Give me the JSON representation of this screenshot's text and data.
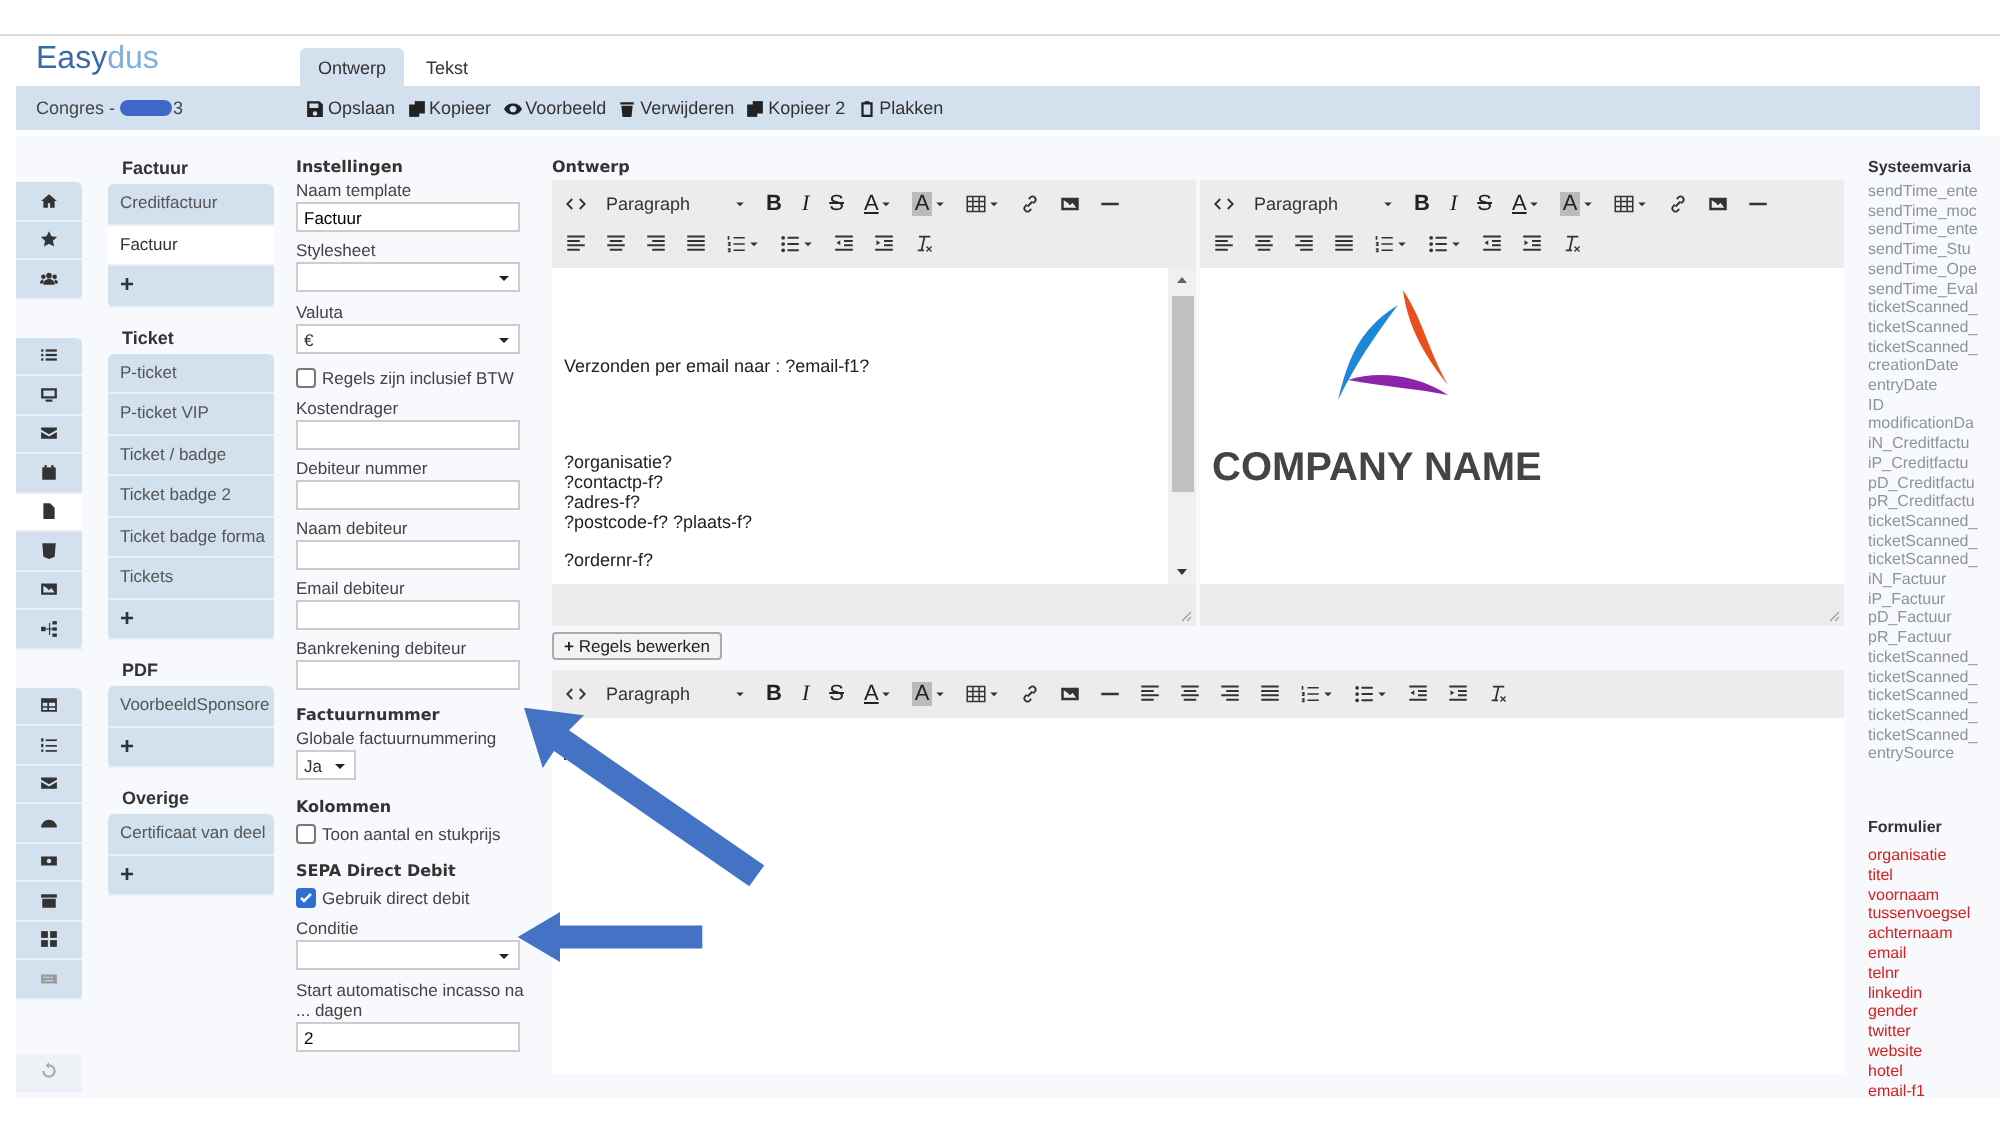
{
  "app": {
    "logo_dark": "Easy",
    "logo_light": "dus"
  },
  "tabs": [
    {
      "label": "Ontwerp",
      "selected": true
    },
    {
      "label": "Tekst",
      "selected": false
    }
  ],
  "project": {
    "name_start": "Congres -",
    "name_end": "3",
    "redacted": true
  },
  "actions": [
    {
      "kind": "save",
      "label": "Opslaan"
    },
    {
      "kind": "copy",
      "label": "Kopieer"
    },
    {
      "kind": "eye",
      "label": "Voorbeeld"
    },
    {
      "kind": "trash",
      "label": "Verwijderen"
    },
    {
      "kind": "copy",
      "label": "Kopieer 2"
    },
    {
      "kind": "paste",
      "label": "Plakken"
    }
  ],
  "nav_groups": [
    [
      {
        "kind": "home",
        "selected": false
      },
      {
        "kind": "star",
        "selected": false
      },
      {
        "kind": "users",
        "selected": false
      }
    ],
    [
      {
        "kind": "list",
        "selected": false
      },
      {
        "kind": "monitor",
        "selected": false
      },
      {
        "kind": "envelope",
        "selected": false
      },
      {
        "kind": "calendar",
        "selected": false
      },
      {
        "kind": "file",
        "selected": true
      },
      {
        "kind": "html5",
        "selected": false
      },
      {
        "kind": "image",
        "selected": false
      },
      {
        "kind": "sitemap",
        "selected": false
      }
    ],
    [
      {
        "kind": "table",
        "selected": false
      },
      {
        "kind": "listol",
        "selected": false
      },
      {
        "kind": "envelope",
        "selected": false
      },
      {
        "kind": "gauge",
        "selected": false
      },
      {
        "kind": "money",
        "selected": false
      },
      {
        "kind": "archive",
        "selected": false
      },
      {
        "kind": "grid",
        "selected": false
      },
      {
        "kind": "keyboard",
        "selected": false,
        "disabled": true
      }
    ]
  ],
  "template_groups": [
    {
      "title": "Factuur",
      "items": [
        {
          "label": "Creditfactuur",
          "selected": false
        },
        {
          "label": "Factuur",
          "selected": true
        }
      ],
      "add": "+"
    },
    {
      "title": "Ticket",
      "items": [
        {
          "label": "P-ticket",
          "selected": false
        },
        {
          "label": "P-ticket VIP",
          "selected": false
        },
        {
          "label": "Ticket / badge",
          "selected": false
        },
        {
          "label": "Ticket badge 2",
          "selected": false
        },
        {
          "label": "Ticket badge forma",
          "selected": false
        },
        {
          "label": "Tickets",
          "selected": false
        }
      ],
      "add": "+"
    },
    {
      "title": "PDF",
      "items": [
        {
          "label": "VoorbeeldSponsore",
          "selected": false
        }
      ],
      "add": "+"
    },
    {
      "title": "Overige",
      "items": [
        {
          "label": "Certificaat van deel",
          "selected": false
        }
      ],
      "add": "+"
    }
  ],
  "settings": [
    {
      "kind": "heading",
      "label": "Instellingen"
    },
    {
      "kind": "text",
      "label": "Naam template",
      "value": "Factuur"
    },
    {
      "kind": "select",
      "label": "Stylesheet"
    },
    {
      "kind": "select",
      "label": "Valuta",
      "value": "€"
    },
    {
      "kind": "checkbox",
      "label": "Regels zijn inclusief BTW",
      "checked": false
    },
    {
      "kind": "text",
      "label": "Kostendrager"
    },
    {
      "kind": "text",
      "label": "Debiteur nummer"
    },
    {
      "kind": "text",
      "label": "Naam debiteur"
    },
    {
      "kind": "text",
      "label": "Email debiteur"
    },
    {
      "kind": "text",
      "label": "Bankrekening debiteur"
    },
    {
      "kind": "heading",
      "label": "Factuurnummer"
    },
    {
      "kind": "smallselect",
      "label": "Globale factuurnummering",
      "value": "Ja"
    },
    {
      "kind": "heading",
      "label": "Kolommen"
    },
    {
      "kind": "checkbox",
      "label": "Toon aantal en stukprijs",
      "checked": false
    },
    {
      "kind": "heading",
      "label": "SEPA Direct Debit"
    },
    {
      "kind": "checkbox",
      "label": "Gebruik direct debit",
      "checked": true
    },
    {
      "kind": "select",
      "label": "Conditie"
    },
    {
      "kind": "text",
      "label": "Start automatische incasso na ... dagen",
      "value": "2"
    }
  ],
  "design": {
    "title": "Ontwerp",
    "editors": [
      {
        "toolbar": [
          [
            {
              "kind": "source"
            },
            {
              "kind": "format",
              "label": "Paragraph"
            },
            {
              "kind": "bold",
              "label": "B"
            },
            {
              "kind": "italic",
              "label": "I"
            },
            {
              "kind": "strike",
              "label": "S"
            },
            {
              "kind": "forecolor",
              "label": "A"
            },
            {
              "kind": "backcolor",
              "label": "A"
            },
            {
              "kind": "table"
            },
            {
              "kind": "link"
            },
            {
              "kind": "image"
            },
            {
              "kind": "hr"
            }
          ],
          [
            {
              "kind": "alignleft"
            },
            {
              "kind": "aligncenter"
            },
            {
              "kind": "alignright"
            },
            {
              "kind": "justify"
            },
            {
              "kind": "numlist"
            },
            {
              "kind": "bullist"
            },
            {
              "kind": "outdent"
            },
            {
              "kind": "indent"
            },
            {
              "kind": "removeformat"
            }
          ]
        ],
        "content": [
          {
            "kind": "para",
            "text": "Verzonden per email naar : ?email-f1?"
          },
          {
            "kind": "para",
            "text": "?organisatie?"
          },
          {
            "kind": "line",
            "text": "?contactp-f?"
          },
          {
            "kind": "line",
            "text": "?adres-f?"
          },
          {
            "kind": "line",
            "text": "?postcode-f? ?plaats-f?"
          },
          {
            "kind": "gap",
            "text": "?ordernr-f?"
          }
        ],
        "scrollbar": true
      },
      {
        "toolbar": [
          [
            {
              "kind": "source"
            },
            {
              "kind": "format",
              "label": "Paragraph"
            },
            {
              "kind": "bold",
              "label": "B"
            },
            {
              "kind": "italic",
              "label": "I"
            },
            {
              "kind": "strike",
              "label": "S"
            },
            {
              "kind": "forecolor",
              "label": "A"
            },
            {
              "kind": "backcolor",
              "label": "A"
            },
            {
              "kind": "table"
            },
            {
              "kind": "link"
            },
            {
              "kind": "image"
            },
            {
              "kind": "hr"
            }
          ],
          [
            {
              "kind": "alignleft"
            },
            {
              "kind": "aligncenter"
            },
            {
              "kind": "alignright"
            },
            {
              "kind": "justify"
            },
            {
              "kind": "numlist"
            },
            {
              "kind": "bullist"
            },
            {
              "kind": "outdent"
            },
            {
              "kind": "indent"
            },
            {
              "kind": "removeformat"
            }
          ]
        ],
        "content": [
          {
            "kind": "logo",
            "text": "COMPANY NAME"
          }
        ],
        "scrollbar": false
      }
    ],
    "rules_button": {
      "icon": "+",
      "label": "Regels bewerken"
    },
    "lines_editor": {
      "toolbar": [
        [
          {
            "kind": "source"
          },
          {
            "kind": "format",
            "label": "Paragraph"
          },
          {
            "kind": "bold",
            "label": "B"
          },
          {
            "kind": "italic",
            "label": "I"
          },
          {
            "kind": "strike",
            "label": "S"
          },
          {
            "kind": "forecolor",
            "label": "A"
          },
          {
            "kind": "backcolor",
            "label": "A"
          },
          {
            "kind": "table"
          },
          {
            "kind": "link"
          },
          {
            "kind": "image"
          },
          {
            "kind": "hr"
          },
          {
            "kind": "alignleft"
          },
          {
            "kind": "aligncenter"
          },
          {
            "kind": "alignright"
          },
          {
            "kind": "justify"
          },
          {
            "kind": "numlist"
          },
          {
            "kind": "bullist"
          },
          {
            "kind": "outdent"
          },
          {
            "kind": "indent"
          },
          {
            "kind": "removeformat"
          }
        ]
      ],
      "cursor": true
    }
  },
  "variables": {
    "system_title": "Systeemvaria",
    "system": [
      "sendTime_ente",
      "sendTime_moc",
      "sendTime_ente",
      "sendTime_Stu",
      "sendTime_Ope",
      "sendTime_Eval",
      "ticketScanned_",
      "ticketScanned_",
      "ticketScanned_",
      "creationDate",
      "entryDate",
      "ID",
      "modificationDa",
      "iN_Creditfactu",
      "iP_Creditfactu",
      "pD_Creditfactu",
      "pR_Creditfactu",
      "ticketScanned_",
      "ticketScanned_",
      "ticketScanned_",
      "iN_Factuur",
      "iP_Factuur",
      "pD_Factuur",
      "pR_Factuur",
      "ticketScanned_",
      "ticketScanned_",
      "ticketScanned_",
      "ticketScanned_",
      "ticketScanned_",
      "entrySource"
    ],
    "form_title": "Formulier",
    "form": [
      "organisatie",
      "titel",
      "voornaam",
      "tussenvoegsel",
      "achternaam",
      "email",
      "telnr",
      "linkedin",
      "gender",
      "twitter",
      "website",
      "hotel",
      "email-f1"
    ]
  },
  "annotations": [
    {
      "kind": "diagonal-arrow"
    },
    {
      "kind": "left-arrow"
    }
  ]
}
